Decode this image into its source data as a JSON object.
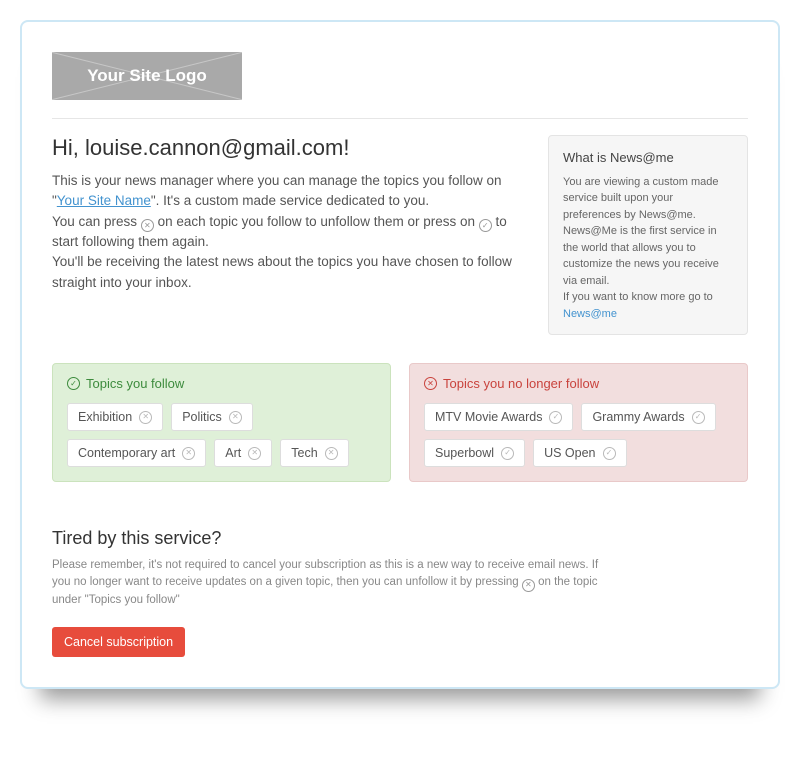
{
  "logo_text": "Your Site Logo",
  "greeting": "Hi, louise.cannon@gmail.com!",
  "intro": {
    "line1a": "This is your news manager where you can manage the topics you follow on \"",
    "site_link": "Your Site Name",
    "line1b": "\". It's a custom made service dedicated to you.",
    "line2a": "You can press ",
    "line2b": " on each topic you follow to unfollow them or press on ",
    "line2c": " to start following them again.",
    "line3": "You'll be receiving the latest news about the topics you have chosen to follow straight into your inbox."
  },
  "sidebar": {
    "title": "What is News@me",
    "body": "You are viewing a custom made service built upon your preferences by News@me. News@Me is the first service in the world that allows you to customize the news you receive via email.",
    "more_prefix": "If you want to know more go to ",
    "link": "News@me"
  },
  "follow": {
    "title": "Topics you follow",
    "items": [
      "Exhibition",
      "Politics",
      "Contemporary art",
      "Art",
      "Tech"
    ]
  },
  "unfollow": {
    "title": "Topics you no longer follow",
    "items": [
      "MTV Movie Awards",
      "Grammy Awards",
      "Superbowl",
      "US Open"
    ]
  },
  "tired": {
    "title": "Tired by this service?",
    "body_a": "Please remember, it's not required to cancel your subscription as this is a new way to receive email news. If you no longer want to receive updates on a given topic, then you can unfollow it by pressing ",
    "body_b": " on the topic under \"Topics you follow\""
  },
  "cancel_label": "Cancel subscription"
}
